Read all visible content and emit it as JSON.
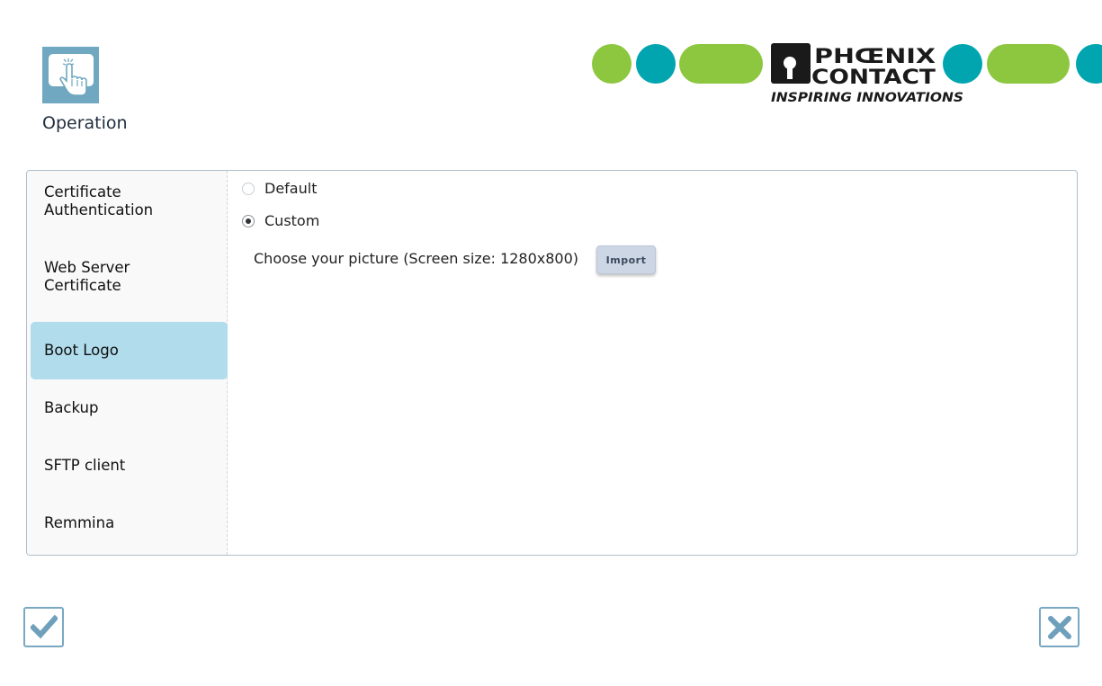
{
  "header": {
    "title": "Operation",
    "icon": "touch-hand-icon",
    "brand": {
      "name_line1": "PHŒNIX",
      "name_line2": "CONTACT",
      "tagline": "INSPIRING INNOVATIONS",
      "colors": {
        "green": "#8dc63f",
        "teal": "#00a5b0",
        "dark": "#1a1a1a"
      }
    }
  },
  "sidebar": {
    "items": [
      {
        "label_line1": "Certificate",
        "label_line2": "Authentication"
      },
      {
        "label_line1": "Web Server",
        "label_line2": "Certificate"
      },
      {
        "label_line1": "Boot Logo",
        "label_line2": ""
      },
      {
        "label_line1": "Backup",
        "label_line2": ""
      },
      {
        "label_line1": "SFTP client",
        "label_line2": ""
      },
      {
        "label_line1": "Remmina",
        "label_line2": ""
      }
    ],
    "active_index": 2,
    "active_color": "#b1dcec"
  },
  "main": {
    "options": [
      {
        "label": "Default",
        "checked": false
      },
      {
        "label": "Custom",
        "checked": true
      }
    ],
    "choose_text": "Choose your picture (Screen size: 1280x800)",
    "import_label": "Import"
  },
  "footer": {
    "ok_icon": "checkmark-icon",
    "cancel_icon": "close-icon",
    "accent": "#7aa8c2"
  }
}
